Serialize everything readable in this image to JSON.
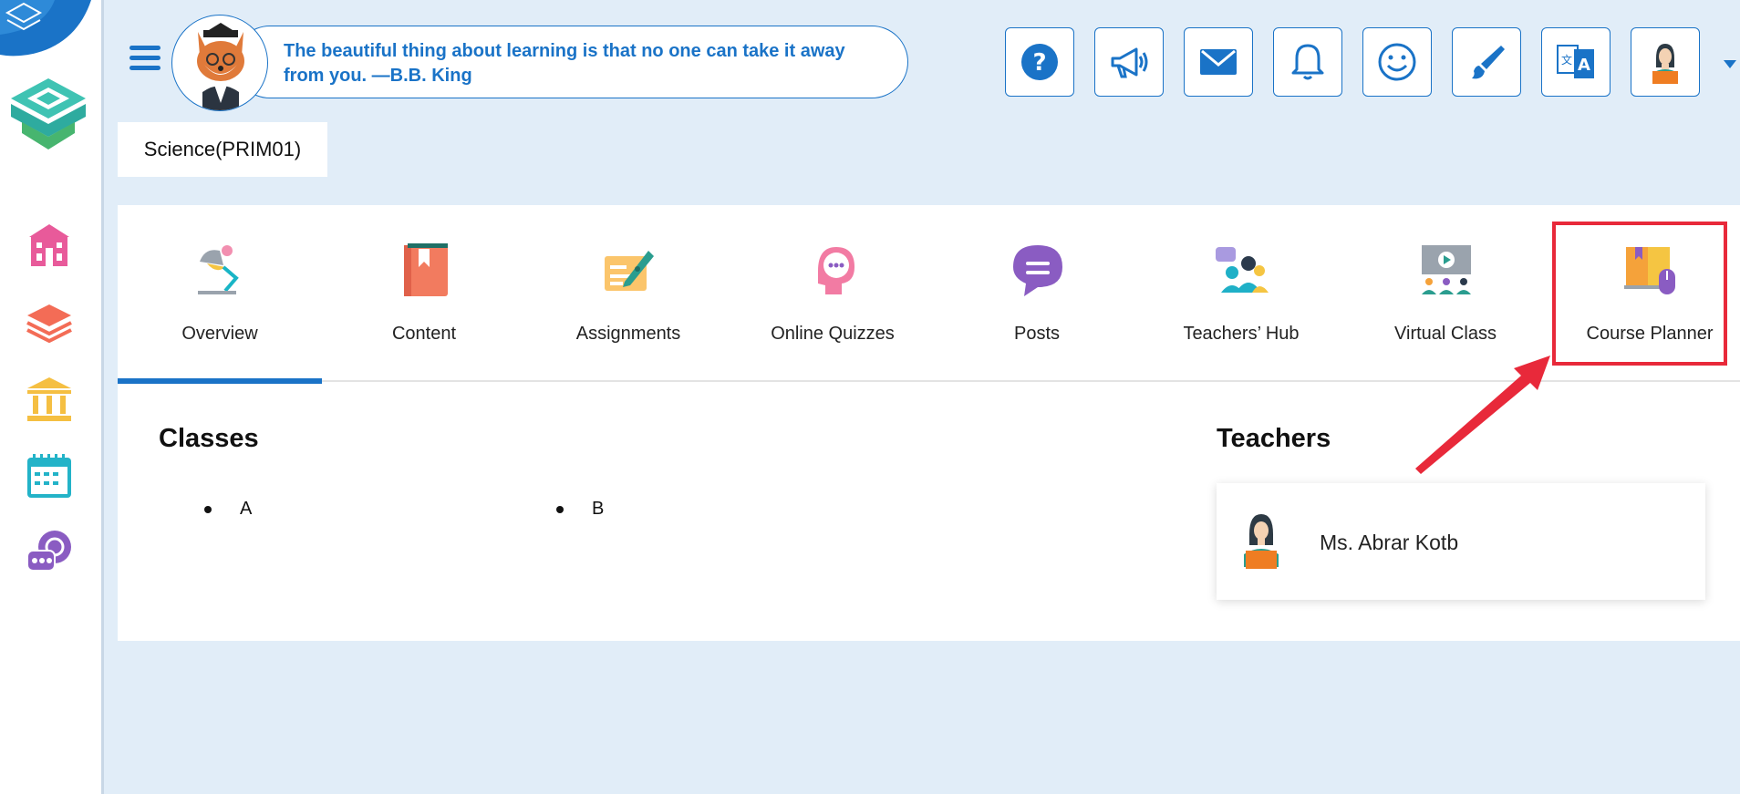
{
  "header": {
    "quote": "The beautiful thing about learning is that no one can take it away from you. —B.B. King",
    "course": "Science(PRIM01)"
  },
  "sidebar": {
    "icons": [
      "school-icon",
      "layers-icon",
      "institution-icon",
      "calendar-icon",
      "chat-icon"
    ]
  },
  "toolbar": {
    "buttons": [
      "help-icon",
      "announcement-icon",
      "mail-icon",
      "notifications-icon",
      "smiley-icon",
      "theme-brush-icon",
      "language-icon",
      "user-avatar-icon"
    ]
  },
  "tabs": [
    {
      "label": "Overview",
      "icon": "desk-lamp-icon",
      "active": true
    },
    {
      "label": "Content",
      "icon": "book-icon"
    },
    {
      "label": "Assignments",
      "icon": "pen-paper-icon"
    },
    {
      "label": "Online Quizzes",
      "icon": "thinking-head-icon"
    },
    {
      "label": "Posts",
      "icon": "message-icon"
    },
    {
      "label": "Teachers’ Hub",
      "icon": "people-chat-icon"
    },
    {
      "label": "Virtual Class",
      "icon": "classroom-icon"
    },
    {
      "label": "Course Planner",
      "icon": "planner-icon",
      "highlighted": true
    }
  ],
  "classes": {
    "title": "Classes",
    "items": [
      "A",
      "B"
    ]
  },
  "teachers": {
    "title": "Teachers",
    "items": [
      "Ms. Abrar Kotb"
    ]
  },
  "colors": {
    "accent": "#1a73c7",
    "background": "#e1edf8",
    "highlight": "#e8293a"
  }
}
